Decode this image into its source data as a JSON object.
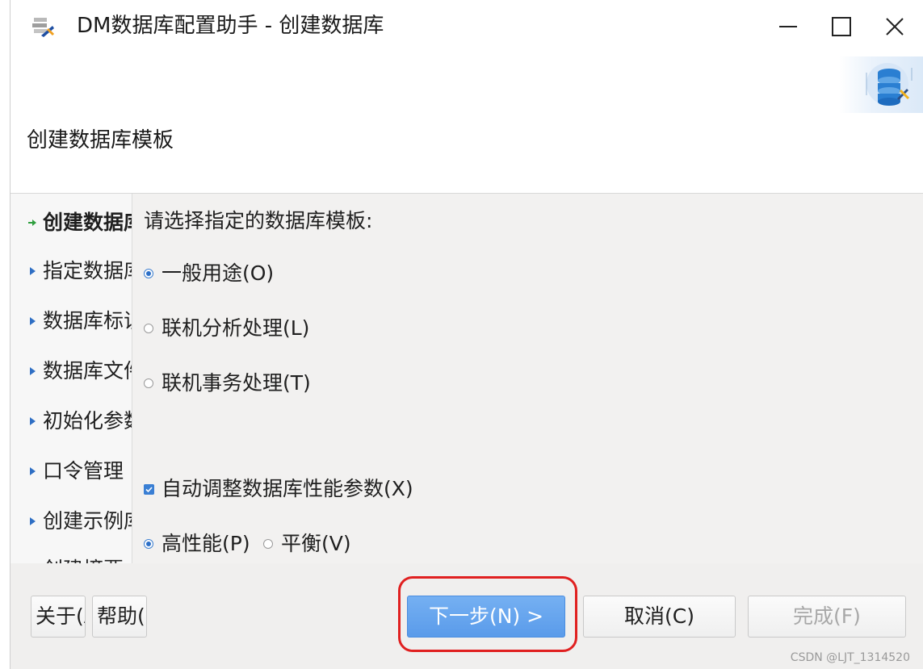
{
  "window": {
    "title": "DM数据库配置助手 - 创建数据库"
  },
  "header": {
    "title": "创建数据库模板"
  },
  "nav": {
    "items": [
      {
        "label": "创建数据库模板",
        "active": true
      },
      {
        "label": "指定数据库目录",
        "active": false
      },
      {
        "label": "数据库标识",
        "active": false
      },
      {
        "label": "数据库文件",
        "active": false
      },
      {
        "label": "初始化参数",
        "active": false
      },
      {
        "label": "口令管理",
        "active": false
      },
      {
        "label": "创建示例库",
        "active": false
      },
      {
        "label": "创建摘要",
        "active": false
      }
    ]
  },
  "content": {
    "prompt": "请选择指定的数据库模板:",
    "templates": [
      {
        "label": "一般用途(O)",
        "checked": true
      },
      {
        "label": "联机分析处理(L)",
        "checked": false
      },
      {
        "label": "联机事务处理(T)",
        "checked": false
      }
    ],
    "auto_tune": {
      "label": "自动调整数据库性能参数(X)",
      "checked": true
    },
    "perf_modes": [
      {
        "label": "高性能(P)",
        "checked": true
      },
      {
        "label": "平衡(V)",
        "checked": false
      }
    ]
  },
  "footer": {
    "about_label": "关于(A)",
    "help_label": "帮助(H)",
    "next_label": "下一步(N) >",
    "cancel_label": "取消(C)",
    "finish_label": "完成(F)"
  },
  "watermark": "CSDN @LJT_1314520",
  "colors": {
    "accent": "#5a9bea",
    "highlight": "#e02020",
    "active_arrow": "#2e9e3e",
    "nav_arrow": "#2f6fc4"
  }
}
